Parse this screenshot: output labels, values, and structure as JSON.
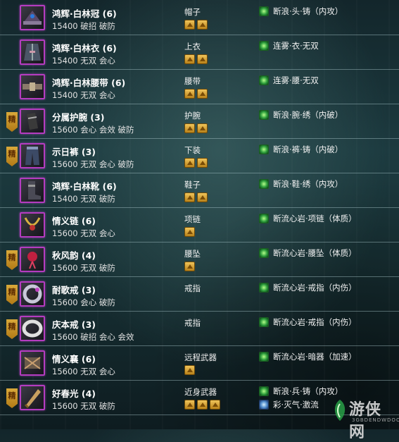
{
  "equipment": [
    {
      "badge": "",
      "icon": "hat-icon",
      "name": "鸿辉·白林冠 (6)",
      "attrs": "15400 破招 破防",
      "slot": "帽子",
      "holes": 2,
      "enchant": "断浪·头·铸（内攻）",
      "enchant2": ""
    },
    {
      "badge": "",
      "icon": "robe-icon",
      "name": "鸿辉·白林衣 (6)",
      "attrs": "15400 无双 会心",
      "slot": "上衣",
      "holes": 2,
      "enchant": "连雾·衣·无双",
      "enchant2": ""
    },
    {
      "badge": "",
      "icon": "belt-icon",
      "name": "鸿辉·白林腰带 (6)",
      "attrs": "15400 无双 会心",
      "slot": "腰带",
      "holes": 2,
      "enchant": "连雾·腰·无双",
      "enchant2": ""
    },
    {
      "badge": "精",
      "icon": "bracer-icon",
      "name": "分属护腕 (3)",
      "attrs": "15600 会心 会效 破防",
      "slot": "护腕",
      "holes": 2,
      "enchant": "断浪·腕·绣（内破）",
      "enchant2": ""
    },
    {
      "badge": "精",
      "icon": "pants-icon",
      "name": "示日裤 (3)",
      "attrs": "15600 无双 会心 破防",
      "slot": "下装",
      "holes": 2,
      "enchant": "断浪·裤·铸（内破）",
      "enchant2": ""
    },
    {
      "badge": "",
      "icon": "boots-icon",
      "name": "鸿辉·白林靴 (6)",
      "attrs": "15400 无双 破防",
      "slot": "鞋子",
      "holes": 2,
      "enchant": "断浪·鞋·绣（内攻）",
      "enchant2": ""
    },
    {
      "badge": "",
      "icon": "necklace-icon",
      "name": "情义链 (6)",
      "attrs": "15600 无双 会心",
      "slot": "项链",
      "holes": 1,
      "enchant": "断流心岩·项链（体质）",
      "enchant2": ""
    },
    {
      "badge": "精",
      "icon": "pendant-icon",
      "name": "秋风韵 (4)",
      "attrs": "15600 无双 破防",
      "slot": "腰坠",
      "holes": 1,
      "enchant": "断流心岩·腰坠（体质）",
      "enchant2": ""
    },
    {
      "badge": "精",
      "icon": "ring-icon",
      "name": "耐歌戒 (3)",
      "attrs": "15600 会心 破防",
      "slot": "戒指",
      "holes": 0,
      "enchant": "断流心岩·戒指（内伤）",
      "enchant2": ""
    },
    {
      "badge": "精",
      "icon": "ring-silver-icon",
      "name": "庆本戒 (3)",
      "attrs": "15600 破招 会心 会效",
      "slot": "戒指",
      "holes": 0,
      "enchant": "断流心岩·戒指（内伤）",
      "enchant2": ""
    },
    {
      "badge": "",
      "icon": "hidden-weapon-icon",
      "name": "情义襄 (6)",
      "attrs": "15600 无双 会心",
      "slot": "远程武器",
      "holes": 1,
      "enchant": "断流心岩·暗器（加速）",
      "enchant2": ""
    },
    {
      "badge": "精",
      "icon": "melee-weapon-icon",
      "name": "好春光 (4)",
      "attrs": "15600 无双 破防",
      "slot": "近身武器",
      "holes": 3,
      "enchant": "断浪·兵·铸（内攻）",
      "enchant2": "彩·灭气·激流"
    }
  ],
  "watermark": {
    "text": "游侠网",
    "url": "3GBDENDWDOOGS"
  },
  "colors": {
    "icon_border": "#b53cc0",
    "badge": "#d9a93a",
    "hole": "#e0b040",
    "enchant_green": "#2a9a3a"
  }
}
